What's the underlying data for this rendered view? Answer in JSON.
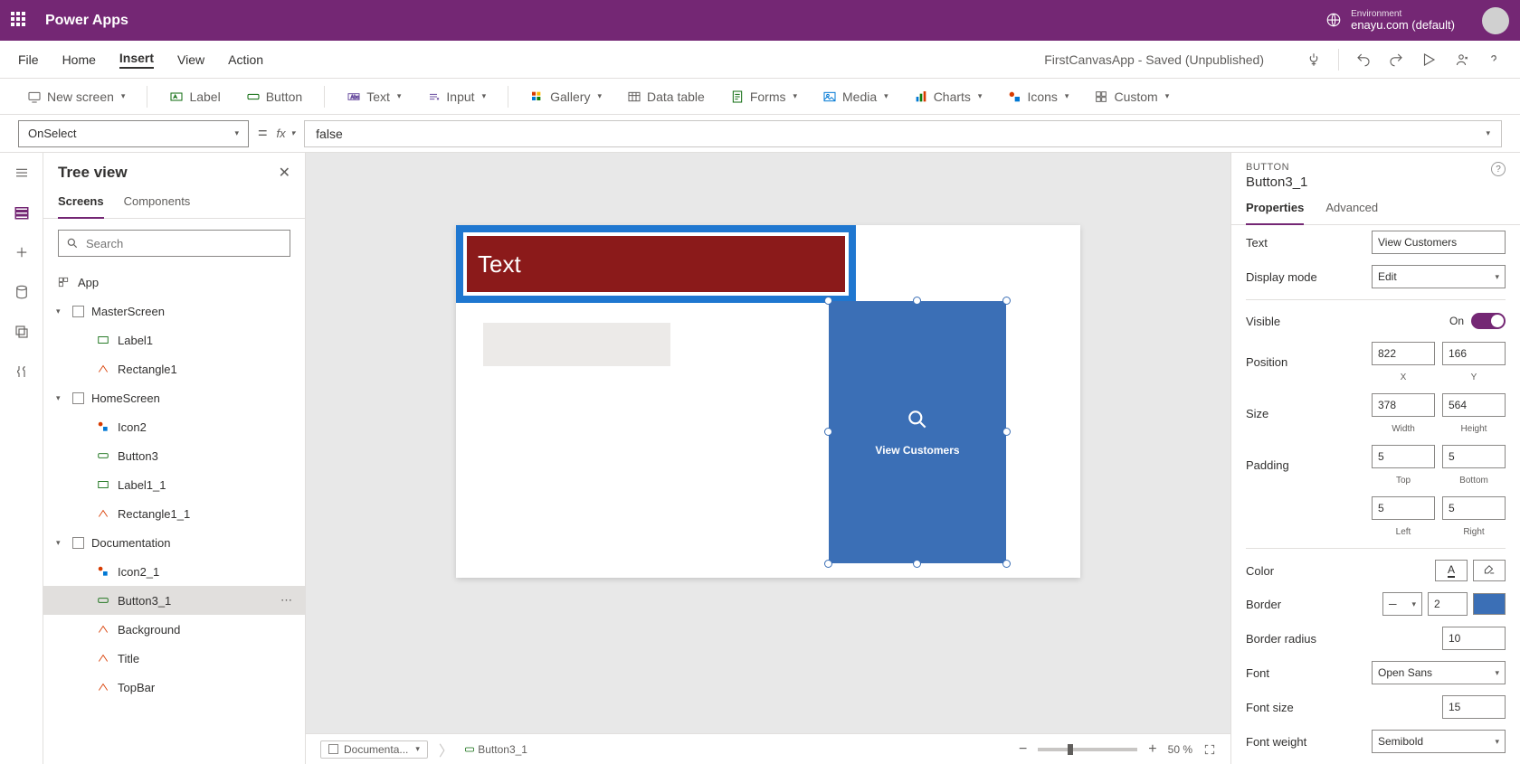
{
  "header": {
    "app_title": "Power Apps",
    "env_label": "Environment",
    "env_name": "enayu.com (default)"
  },
  "menu": {
    "items": [
      "File",
      "Home",
      "Insert",
      "View",
      "Action"
    ],
    "active": "Insert",
    "app_status": "FirstCanvasApp - Saved (Unpublished)"
  },
  "ribbon": {
    "new_screen": "New screen",
    "label": "Label",
    "button": "Button",
    "text": "Text",
    "input": "Input",
    "gallery": "Gallery",
    "data_table": "Data table",
    "forms": "Forms",
    "media": "Media",
    "charts": "Charts",
    "icons": "Icons",
    "custom": "Custom"
  },
  "formula": {
    "property": "OnSelect",
    "value": "false"
  },
  "tree": {
    "title": "Tree view",
    "tabs": {
      "screens": "Screens",
      "components": "Components"
    },
    "search_placeholder": "Search",
    "app": "App",
    "screens": [
      {
        "name": "MasterScreen",
        "items": [
          "Label1",
          "Rectangle1"
        ]
      },
      {
        "name": "HomeScreen",
        "items": [
          "Icon2",
          "Button3",
          "Label1_1",
          "Rectangle1_1"
        ]
      },
      {
        "name": "Documentation",
        "items": [
          "Icon2_1",
          "Button3_1",
          "Background",
          "Title",
          "TopBar"
        ]
      }
    ],
    "selected": "Button3_1"
  },
  "canvas": {
    "text_label": "Text",
    "button_label": "View Customers",
    "breadcrumb_screen": "Documenta...",
    "breadcrumb_item": "Button3_1",
    "zoom": "50  %"
  },
  "props": {
    "type": "BUTTON",
    "name": "Button3_1",
    "tabs": {
      "properties": "Properties",
      "advanced": "Advanced"
    },
    "text_label": "Text",
    "text_value": "View Customers",
    "display_mode_label": "Display mode",
    "display_mode_value": "Edit",
    "visible_label": "Visible",
    "visible_state": "On",
    "position_label": "Position",
    "pos_x": "822",
    "pos_y": "166",
    "x_lbl": "X",
    "y_lbl": "Y",
    "size_label": "Size",
    "width": "378",
    "height": "564",
    "w_lbl": "Width",
    "h_lbl": "Height",
    "padding_label": "Padding",
    "pad_top": "5",
    "pad_bottom": "5",
    "pad_left": "5",
    "pad_right": "5",
    "top_lbl": "Top",
    "bottom_lbl": "Bottom",
    "left_lbl": "Left",
    "right_lbl": "Right",
    "color_label": "Color",
    "border_label": "Border",
    "border_value": "2",
    "border_radius_label": "Border radius",
    "border_radius_value": "10",
    "font_label": "Font",
    "font_value": "Open Sans",
    "font_size_label": "Font size",
    "font_size_value": "15",
    "font_weight_label": "Font weight",
    "font_weight_value": "Semibold"
  }
}
